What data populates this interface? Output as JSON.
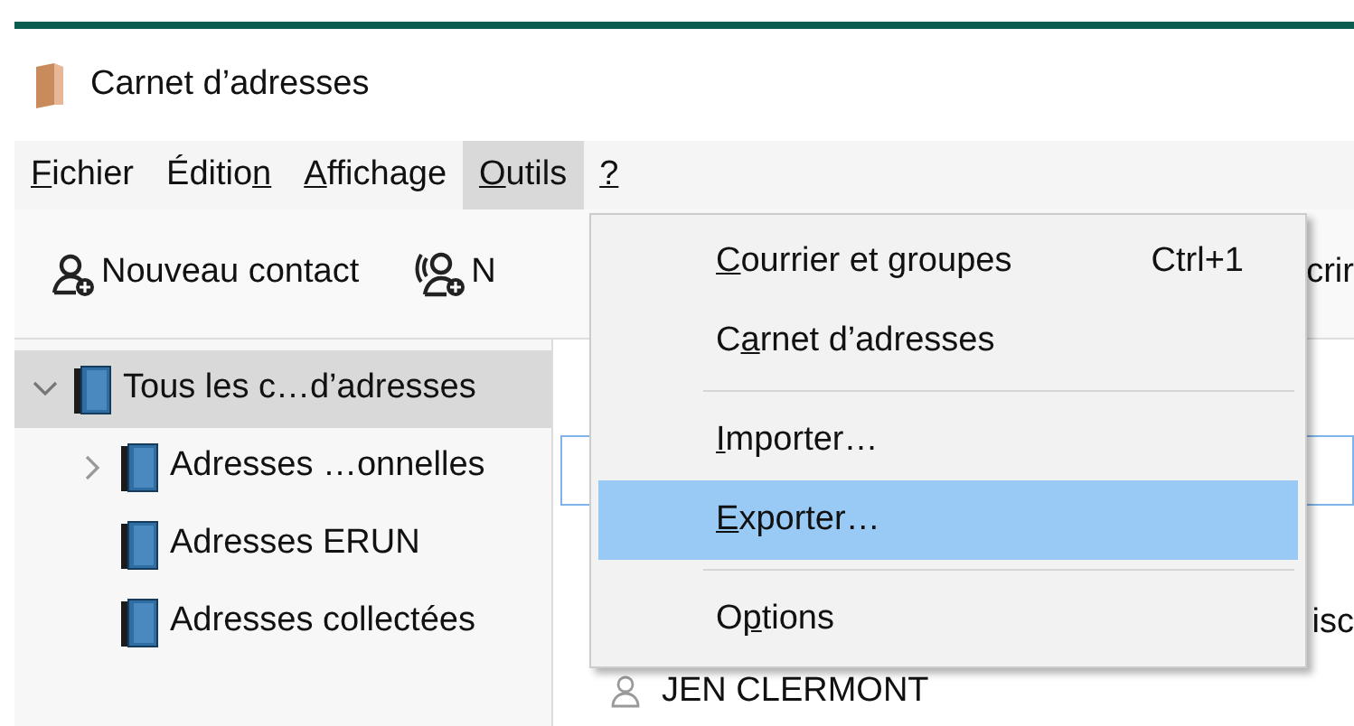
{
  "window": {
    "title": "Carnet d’adresses"
  },
  "menubar": [
    {
      "key": "F",
      "post": "ichier",
      "selected": false
    },
    {
      "pre": "Éditio",
      "key": "n",
      "selected": false
    },
    {
      "key": "A",
      "post": "ffichage",
      "selected": false
    },
    {
      "key": "O",
      "post": "utils",
      "selected": true
    },
    {
      "key": "?",
      "selected": false
    }
  ],
  "toolbar": [
    {
      "kind": "contact",
      "label": "Nouveau contact"
    },
    {
      "kind": "list",
      "label": "N"
    },
    {
      "kind": "text",
      "label": "crir"
    }
  ],
  "sidebar": {
    "items": [
      {
        "label": "Tous les c…d’adresses",
        "expanded": true,
        "selected": true,
        "children": [
          {
            "label": "Adresses …onnelles",
            "expanded": false,
            "selected": false
          },
          {
            "label": "Adresses ERUN",
            "selected": false
          },
          {
            "label": "Adresses collectées",
            "selected": false
          }
        ]
      }
    ]
  },
  "contacts": [
    {
      "column_2": "isc"
    },
    {
      "name": "JEN CLERMONT"
    }
  ],
  "menu": [
    {
      "kind": "item",
      "key": "C",
      "post": "ourrier et groupes",
      "shortcut": "Ctrl+1",
      "selected": false
    },
    {
      "kind": "item",
      "pre": "C",
      "key": "a",
      "post": "rnet d’adresses",
      "selected": false
    },
    {
      "kind": "separator"
    },
    {
      "kind": "item",
      "key": "I",
      "post": "mporter…",
      "selected": false
    },
    {
      "kind": "item",
      "key": "E",
      "post": "xporter…",
      "selected": true
    },
    {
      "kind": "separator"
    },
    {
      "kind": "item",
      "pre": "O",
      "key": "p",
      "post": "tions",
      "selected": false
    }
  ]
}
